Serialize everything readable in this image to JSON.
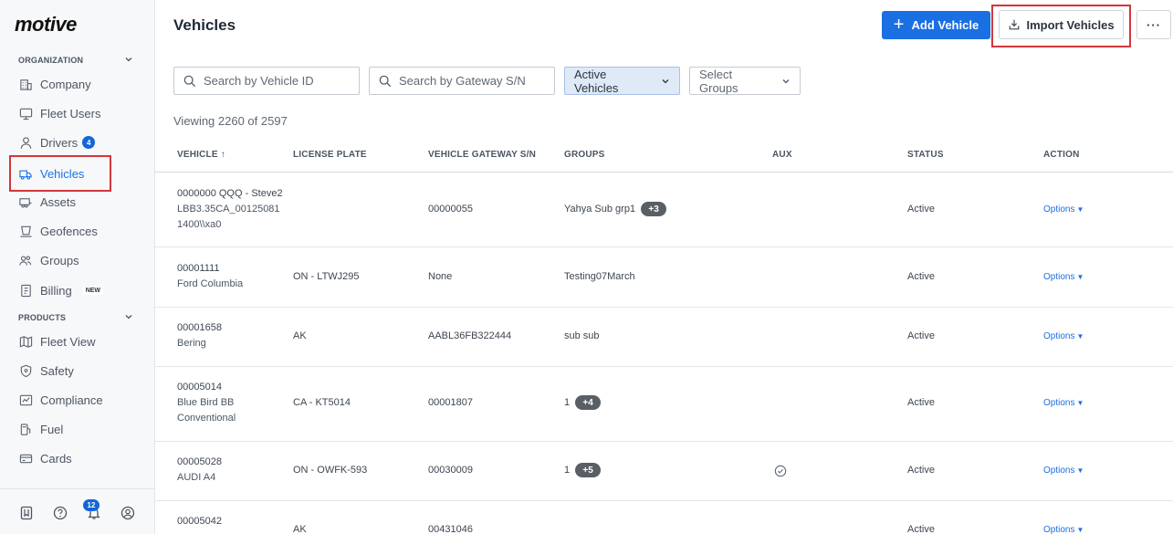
{
  "brand": {
    "logo": "motive"
  },
  "sidebar": {
    "organization_label": "ORGANIZATION",
    "products_label": "PRODUCTS",
    "org_items": [
      {
        "label": "Company",
        "icon": "building-icon"
      },
      {
        "label": "Fleet Users",
        "icon": "monitor-icon"
      },
      {
        "label": "Drivers",
        "icon": "person-icon",
        "badge": "4"
      },
      {
        "label": "Vehicles",
        "icon": "truck-icon",
        "active": true
      },
      {
        "label": "Assets",
        "icon": "trailer-icon"
      },
      {
        "label": "Geofences",
        "icon": "geofence-icon"
      },
      {
        "label": "Groups",
        "icon": "groups-icon"
      },
      {
        "label": "Billing",
        "icon": "billing-icon",
        "tag": "NEW"
      }
    ],
    "product_items": [
      {
        "label": "Fleet View",
        "icon": "map-icon"
      },
      {
        "label": "Safety",
        "icon": "shield-icon"
      },
      {
        "label": "Compliance",
        "icon": "compliance-icon"
      },
      {
        "label": "Fuel",
        "icon": "fuel-icon"
      },
      {
        "label": "Cards",
        "icon": "card-icon"
      }
    ],
    "footer": {
      "notifications_count": "12"
    }
  },
  "header": {
    "title": "Vehicles",
    "add_label": "Add Vehicle",
    "import_label": "Import Vehicles",
    "more_label": "···"
  },
  "filters": {
    "search_vehicle_placeholder": "Search by Vehicle ID",
    "search_gateway_placeholder": "Search by Gateway S/N",
    "status_select": "Active Vehicles",
    "groups_select": "Select Groups"
  },
  "viewing": "Viewing 2260 of 2597",
  "table": {
    "headers": {
      "vehicle": "VEHICLE ↑",
      "license": "LICENSE PLATE",
      "gateway": "VEHICLE GATEWAY S/N",
      "groups": "GROUPS",
      "aux": "AUX",
      "status": "STATUS",
      "action": "ACTION"
    },
    "rows": [
      {
        "line1": "0000000 QQQ - Steve2",
        "line2": "LBB3.35CA_00125081",
        "line3": "1400\\\\xa0",
        "license": "",
        "gateway": "00000055",
        "groups": "Yahya Sub grp1",
        "groups_more": "+3",
        "aux": false,
        "status": "Active",
        "action": "Options"
      },
      {
        "line1": "00001111",
        "line2": "Ford Columbia",
        "line3": "",
        "license": "ON - LTWJ295",
        "gateway": "None",
        "groups": "Testing07March",
        "groups_more": "",
        "aux": false,
        "status": "Active",
        "action": "Options"
      },
      {
        "line1": "00001658",
        "line2": "Bering",
        "line3": "",
        "license": "AK",
        "gateway": "AABL36FB322444",
        "groups": "sub sub",
        "groups_more": "",
        "aux": false,
        "status": "Active",
        "action": "Options"
      },
      {
        "line1": "00005014",
        "line2": "Blue Bird BB",
        "line3": "Conventional",
        "license": "CA - KT5014",
        "gateway": "00001807",
        "groups": "1",
        "groups_more": "+4",
        "aux": false,
        "status": "Active",
        "action": "Options"
      },
      {
        "line1": "00005028",
        "line2": "AUDI A4",
        "line3": "",
        "license": "ON - OWFK-593",
        "gateway": "00030009",
        "groups": "1",
        "groups_more": "+5",
        "aux": true,
        "status": "Active",
        "action": "Options"
      },
      {
        "line1": "00005042",
        "line2": "",
        "line3": "",
        "license": "AK",
        "gateway": "00431046",
        "groups": "",
        "groups_more": "",
        "aux": false,
        "status": "Active",
        "action": "Options"
      }
    ]
  }
}
